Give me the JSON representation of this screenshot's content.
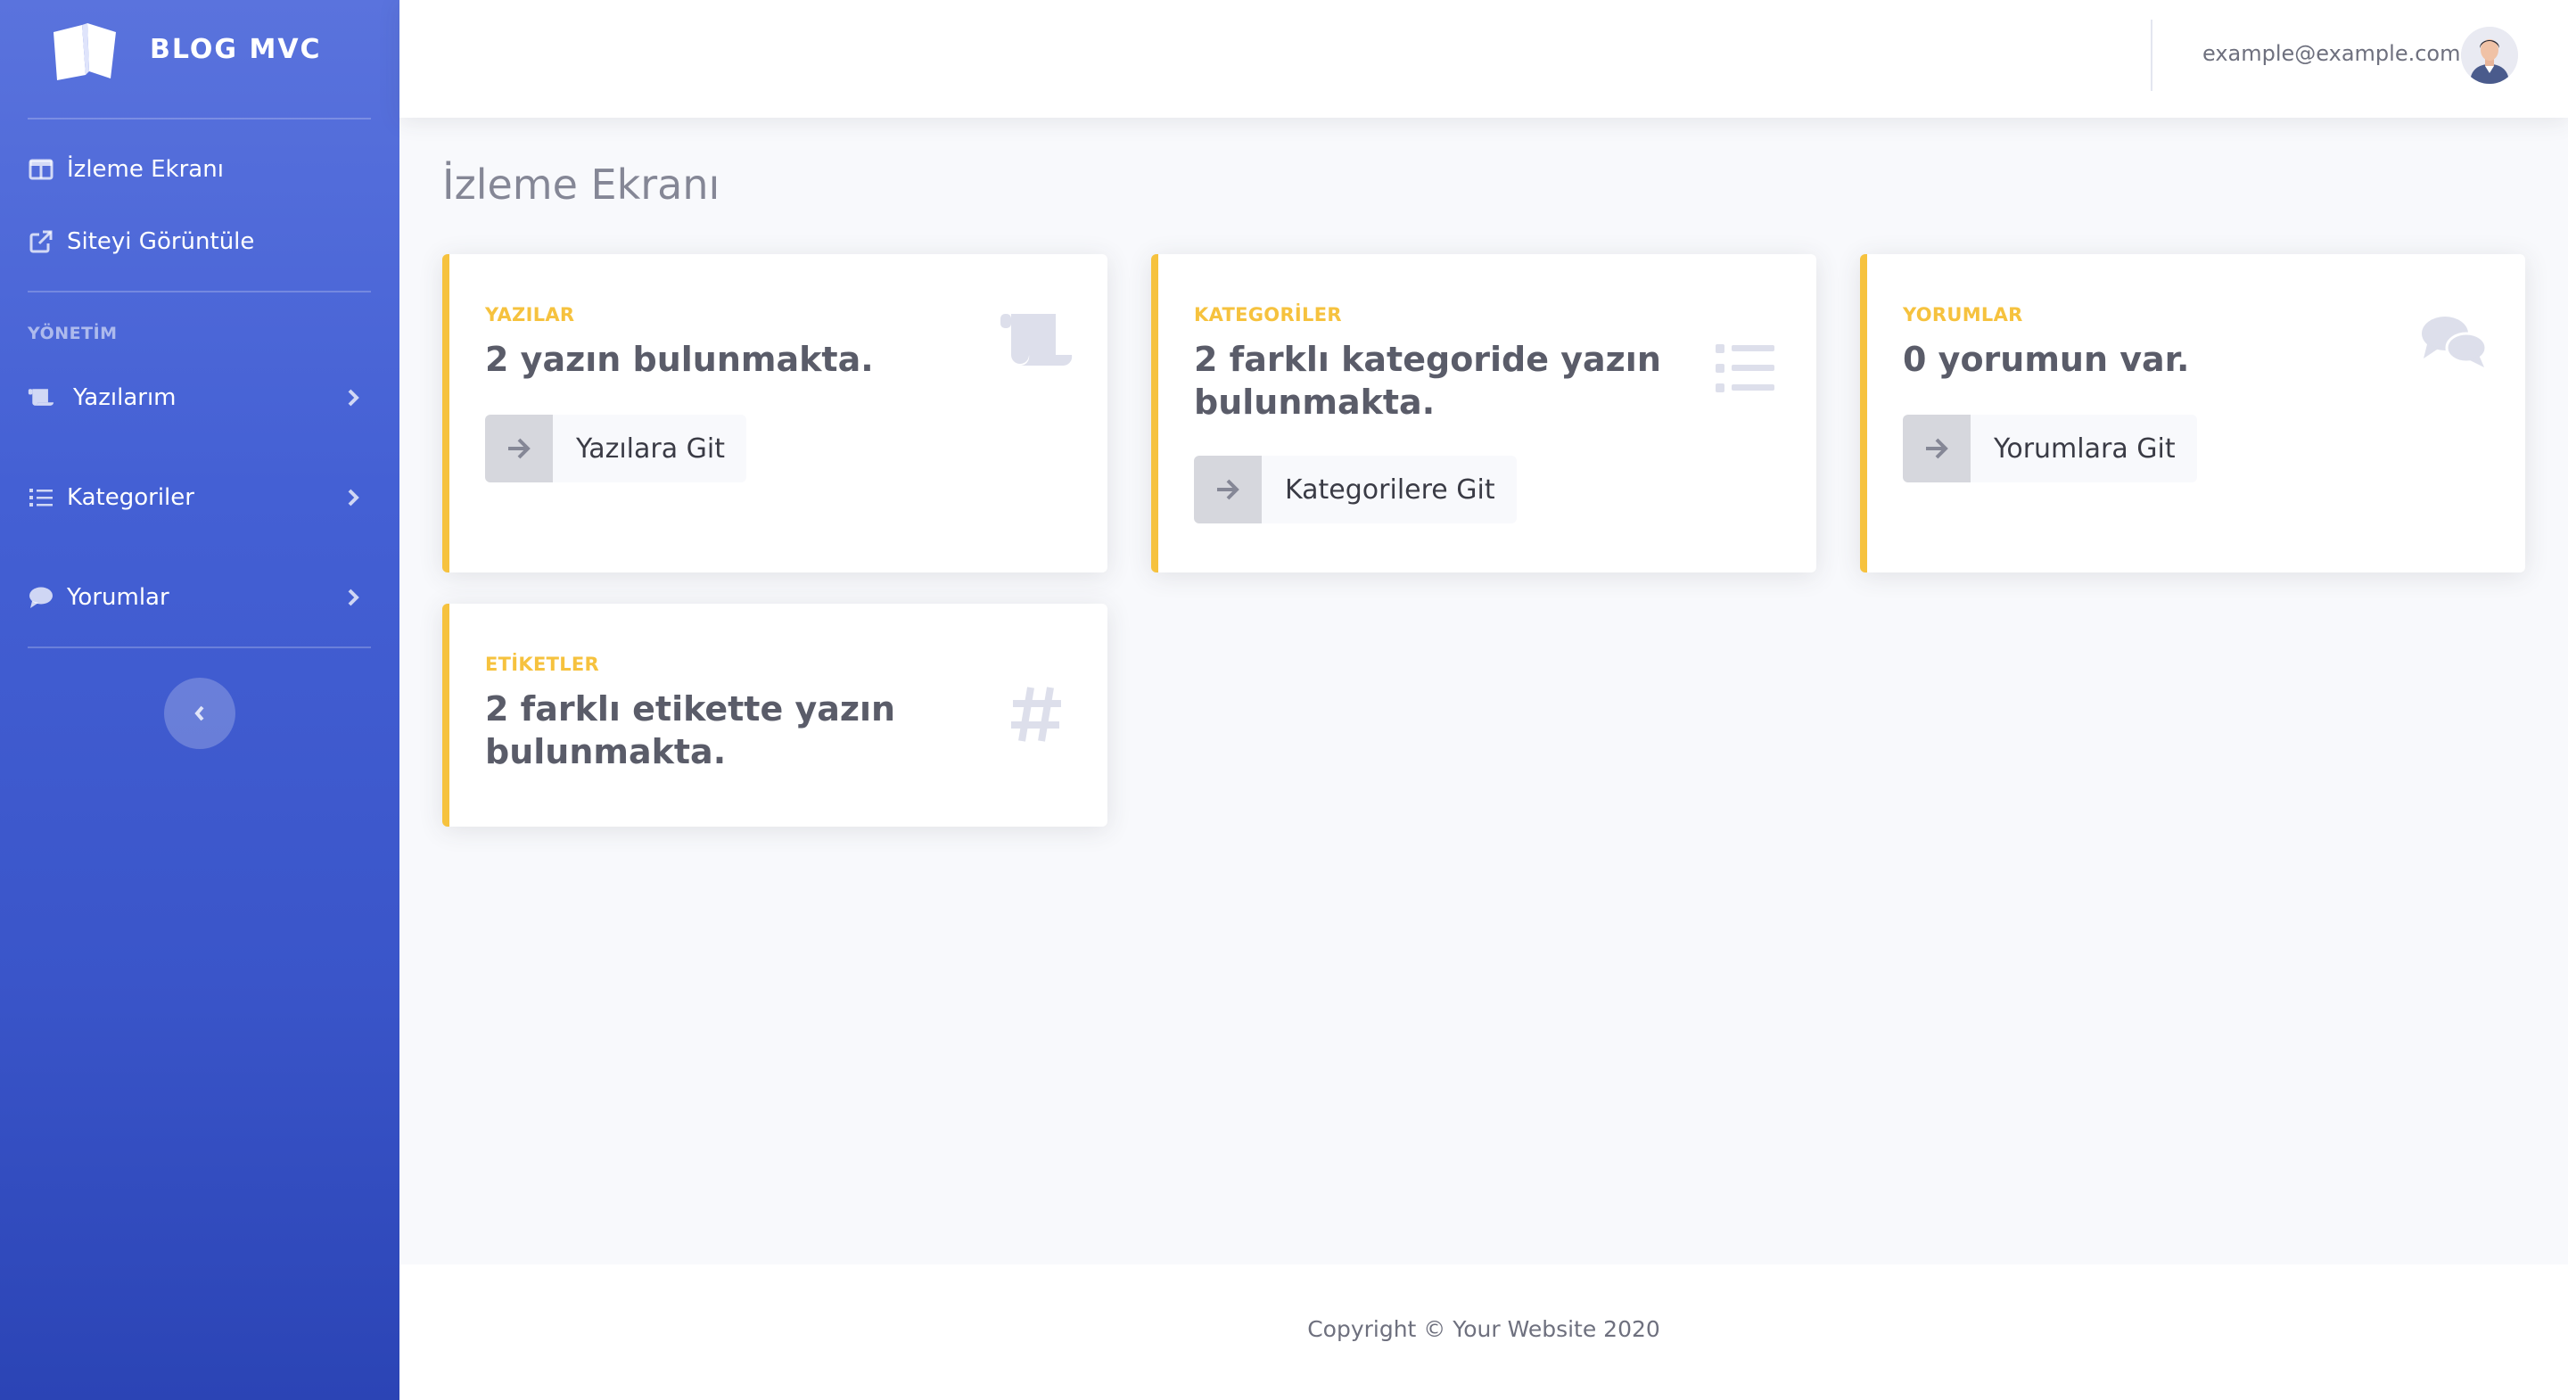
{
  "brand": {
    "name": "BLOG MVC",
    "icon": "book-open-icon"
  },
  "sidebar": {
    "items": [
      {
        "label": "İzleme Ekranı",
        "icon": "columns-icon"
      },
      {
        "label": "Siteyi Görüntüle",
        "icon": "external-link-icon"
      }
    ],
    "section_heading": "YÖNETİM",
    "admin_items": [
      {
        "label": "Yazılarım",
        "icon": "scroll-icon"
      },
      {
        "label": "Kategoriler",
        "icon": "list-icon"
      },
      {
        "label": "Yorumlar",
        "icon": "comment-icon"
      }
    ],
    "toggle_icon": "chevron-left-icon"
  },
  "topbar": {
    "user_email": "example@example.com",
    "avatar": "user-avatar"
  },
  "main": {
    "title": "İzleme Ekranı",
    "cards": [
      {
        "label": "YAZILAR",
        "text": "2 yazın bulunmakta.",
        "button": "Yazılara Git",
        "icon": "scroll-icon"
      },
      {
        "label": "KATEGORİLER",
        "text": "2 farklı kategoride yazın bulunmakta.",
        "button": "Kategorilere Git",
        "icon": "list-icon"
      },
      {
        "label": "YORUMLAR",
        "text": "0 yorumun var.",
        "button": "Yorumlara Git",
        "icon": "comments-icon"
      },
      {
        "label": "ETİKETLER",
        "text": "2 farklı etikette yazın bulunmakta.",
        "icon": "hashtag-icon"
      }
    ]
  },
  "footer": {
    "copyright": "Copyright © Your Website 2020"
  },
  "colors": {
    "sidebar_top": "#5a73dd",
    "sidebar_bottom": "#2b44b5",
    "accent_warning": "#f6c23e",
    "background": "#f8f9fc",
    "card_text": "#5a5c69",
    "icon_muted": "#dddfeb"
  }
}
